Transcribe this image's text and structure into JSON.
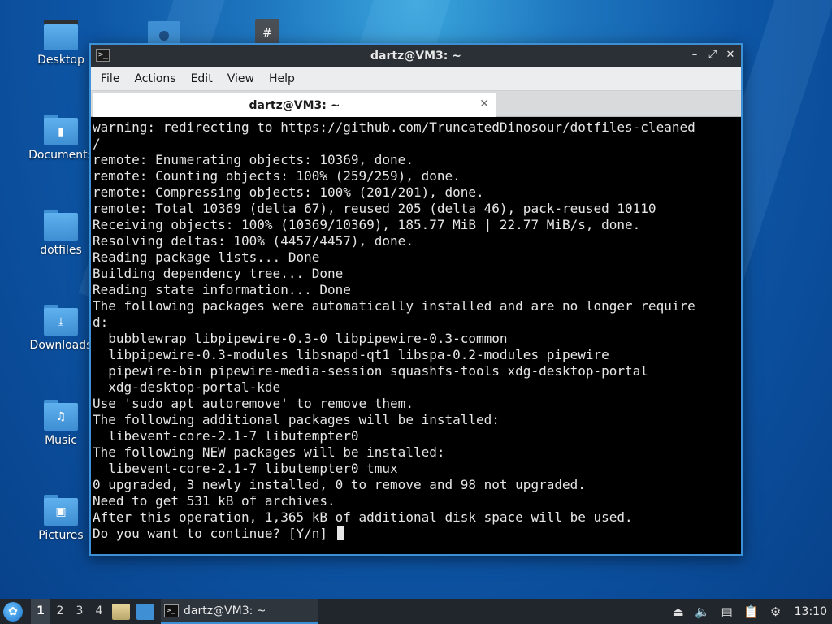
{
  "desktop": {
    "icons": [
      {
        "label": "Desktop",
        "icon": "desktop-folder-icon"
      },
      {
        "label": "Documents",
        "icon": "documents-folder-icon"
      },
      {
        "label": "dotfiles",
        "icon": "folder-icon"
      },
      {
        "label": "Downloads",
        "icon": "downloads-folder-icon"
      },
      {
        "label": "Music",
        "icon": "music-folder-icon"
      },
      {
        "label": "Pictures",
        "icon": "pictures-folder-icon"
      }
    ]
  },
  "window": {
    "title": "dartz@VM3: ~",
    "menu": [
      "File",
      "Actions",
      "Edit",
      "View",
      "Help"
    ],
    "tab_label": "dartz@VM3: ~"
  },
  "terminal": {
    "lines": [
      "warning: redirecting to https://github.com/TruncatedDinosour/dotfiles-cleaned",
      "/",
      "remote: Enumerating objects: 10369, done.",
      "remote: Counting objects: 100% (259/259), done.",
      "remote: Compressing objects: 100% (201/201), done.",
      "remote: Total 10369 (delta 67), reused 205 (delta 46), pack-reused 10110",
      "Receiving objects: 100% (10369/10369), 185.77 MiB | 22.77 MiB/s, done.",
      "Resolving deltas: 100% (4457/4457), done.",
      "Reading package lists... Done",
      "Building dependency tree... Done",
      "Reading state information... Done",
      "The following packages were automatically installed and are no longer require",
      "d:",
      "  bubblewrap libpipewire-0.3-0 libpipewire-0.3-common",
      "  libpipewire-0.3-modules libsnapd-qt1 libspa-0.2-modules pipewire",
      "  pipewire-bin pipewire-media-session squashfs-tools xdg-desktop-portal",
      "  xdg-desktop-portal-kde",
      "Use 'sudo apt autoremove' to remove them.",
      "The following additional packages will be installed:",
      "  libevent-core-2.1-7 libutempter0",
      "The following NEW packages will be installed:",
      "  libevent-core-2.1-7 libutempter0 tmux",
      "0 upgraded, 3 newly installed, 0 to remove and 98 not upgraded.",
      "Need to get 531 kB of archives.",
      "After this operation, 1,365 kB of additional disk space will be used."
    ],
    "prompt": "Do you want to continue? [Y/n] "
  },
  "taskbar": {
    "workspaces": [
      "1",
      "2",
      "3",
      "4"
    ],
    "active_workspace": "1",
    "task_label": "dartz@VM3: ~",
    "clock": "13:10"
  }
}
